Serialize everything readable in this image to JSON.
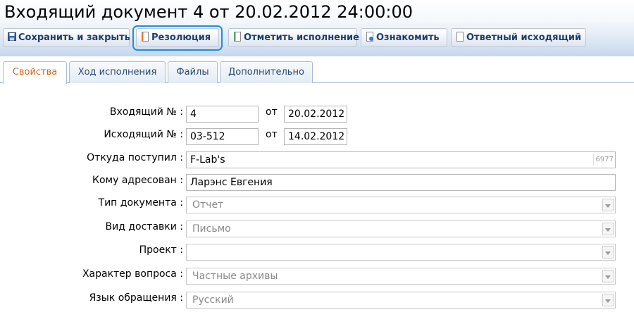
{
  "window": {
    "title": "Входящий документ 4 от 20.02.2012 24:00:00"
  },
  "toolbar": {
    "buttons": [
      {
        "label": "Сохранить и закрыть",
        "icon": "floppy-disk-icon"
      },
      {
        "label": "Резолюция",
        "icon": "document-icon",
        "highlighted": true
      },
      {
        "label": "Отметить исполнение",
        "icon": "document-check-icon"
      },
      {
        "label": "Ознакомить",
        "icon": "document-view-icon"
      },
      {
        "label": "Ответный исходящий",
        "icon": "document-icon"
      }
    ]
  },
  "tabs": [
    {
      "label": "Свойства",
      "active": true
    },
    {
      "label": "Ход исполнения",
      "active": false
    },
    {
      "label": "Файлы",
      "active": false
    },
    {
      "label": "Дополнительно",
      "active": false
    }
  ],
  "form": {
    "incoming_no": {
      "label": "Входящий № :",
      "value": "4",
      "from_label": "от",
      "date": "20.02.2012"
    },
    "outgoing_no": {
      "label": "Исходящий № :",
      "value": "03-512",
      "from_label": "от",
      "date": "14.02.2012"
    },
    "source": {
      "label": "Откуда поступил :",
      "value": "F-Lab's",
      "counter": "6977"
    },
    "addressee": {
      "label": "Кому адресован :",
      "value": "Ларэнс Евгения"
    },
    "doc_type": {
      "label": "Тип документа :",
      "value": "Отчет"
    },
    "delivery": {
      "label": "Вид доставки :",
      "value": "Письмо"
    },
    "project": {
      "label": "Проект :",
      "value": ""
    },
    "question_type": {
      "label": "Характер вопроса :",
      "value": "Частные архивы"
    },
    "language": {
      "label": "Язык обращения :",
      "value": "Русский"
    }
  },
  "colors": {
    "accent": "#1e8fd6",
    "active_tab_text": "#d2691e",
    "button_text": "#1f3d6b"
  }
}
